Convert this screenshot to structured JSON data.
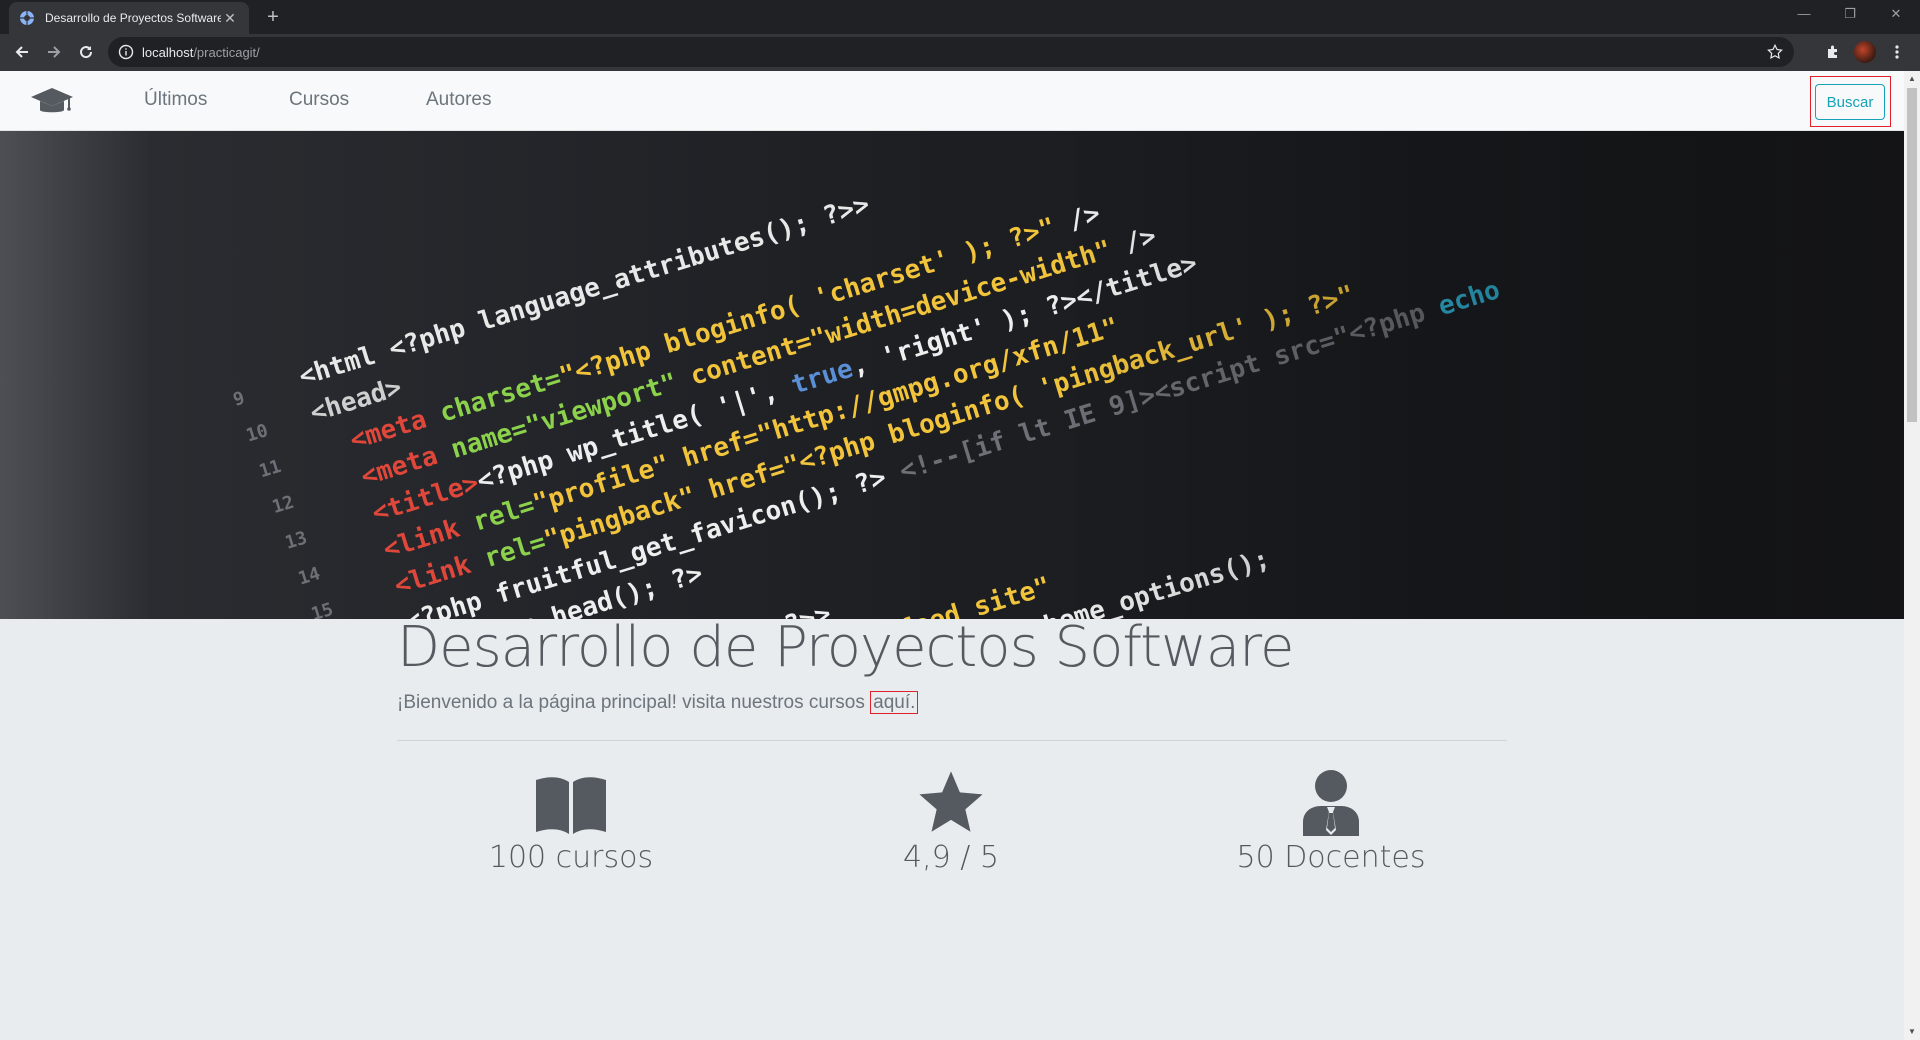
{
  "browser": {
    "tab_title": "Desarrollo de Proyectos Software",
    "url_host": "localhost",
    "url_path": "/practicagit/"
  },
  "navbar": {
    "links": [
      {
        "label": "Últimos"
      },
      {
        "label": "Cursos"
      },
      {
        "label": "Autores"
      }
    ],
    "search_button": "Buscar",
    "accent": "#17a2b8"
  },
  "jumbotron": {
    "title": "Desarrollo de Proyectos Software",
    "lead": "¡Bienvenido a la página principal! visita nuestros cursos ",
    "link_text": "aquí."
  },
  "stats": [
    {
      "icon": "book-icon",
      "label": "100 cursos"
    },
    {
      "icon": "star-icon",
      "label": "4,9 / 5"
    },
    {
      "icon": "user-tie-icon",
      "label": "50 Docentes"
    }
  ],
  "icons": {
    "brand": "graduation-cap-icon",
    "hero": "code-editor-image"
  }
}
